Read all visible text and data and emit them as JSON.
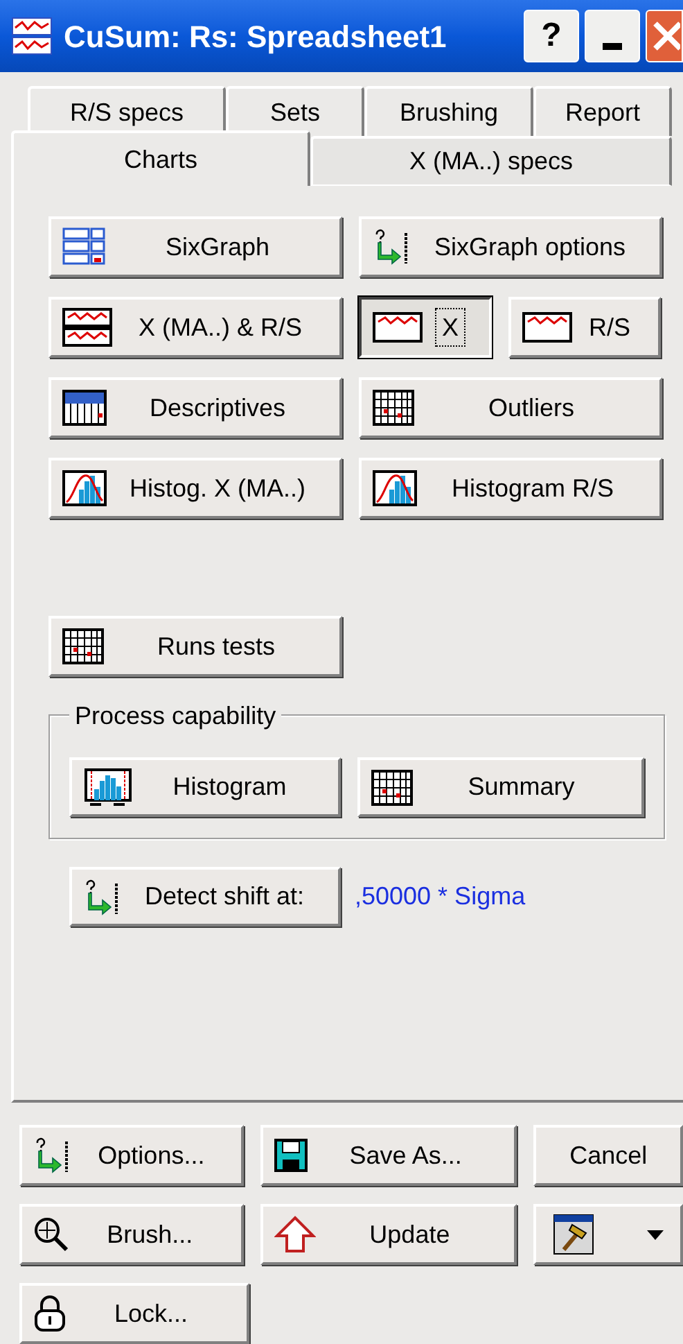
{
  "window": {
    "title": "CuSum: Rs: Spreadsheet1",
    "controls": [
      "?"
    ]
  },
  "tabs_back": [
    {
      "label": "R/S specs",
      "selected": false
    },
    {
      "label": "Sets",
      "selected": false
    },
    {
      "label": "Brushing",
      "selected": false
    },
    {
      "label": "Report",
      "selected": false
    }
  ],
  "tabs_front": [
    {
      "label": "Charts",
      "selected": true
    },
    {
      "label": "X (MA..) specs",
      "selected": false
    }
  ],
  "chart_buttons": [
    {
      "label": "SixGraph",
      "pressed": false
    },
    {
      "label": "SixGraph options",
      "pressed": false
    },
    {
      "label": "X (MA..) & R/S",
      "pressed": false
    },
    {
      "label": "X",
      "pressed": true
    },
    {
      "label": "R/S",
      "pressed": false
    },
    {
      "label": "Descriptives",
      "pressed": false
    },
    {
      "label": "Outliers",
      "pressed": false
    },
    {
      "label": "Histog. X (MA..)",
      "pressed": false
    },
    {
      "label": "Histogram R/S",
      "pressed": false
    }
  ],
  "runs_tests": {
    "label": "Runs tests"
  },
  "process_capability": {
    "title": "Process capability",
    "buttons": [
      "Histogram",
      "Summary"
    ]
  },
  "detect_shift": {
    "label": "Detect shift at:",
    "value": ",50000 * Sigma"
  },
  "footer_buttons": [
    "Options...",
    "Save As...",
    "Cancel",
    "Brush...",
    "Update",
    "Lock..."
  ]
}
